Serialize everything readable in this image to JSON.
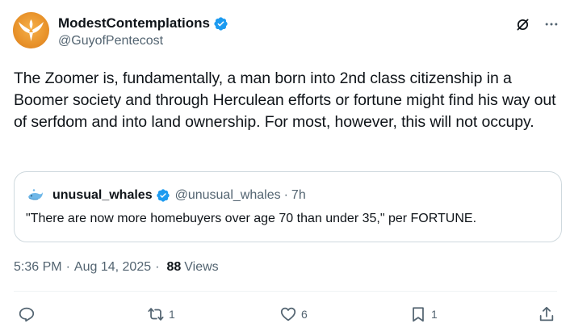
{
  "author": {
    "display_name": "ModestContemplations",
    "handle": "@GuyofPentecost",
    "verified": true
  },
  "tweet": {
    "text": "The Zoomer is, fundamentally, a man born into 2nd class citizenship in a Boomer society and through Herculean efforts or fortune might find his way out of serfdom and into land ownership. For most, however, this will not occupy."
  },
  "quoted": {
    "display_name": "unusual_whales",
    "handle": "@unusual_whales",
    "separator": "·",
    "time": "7h",
    "text": "\"There are now more homebuyers over age 70 than under 35,\" per FORTUNE."
  },
  "meta": {
    "time": "5:36 PM",
    "date": "Aug 14, 2025",
    "dot": "·",
    "views_count": "88",
    "views_label": "Views"
  },
  "actions": {
    "reply_count": "",
    "repost_count": "1",
    "like_count": "6",
    "bookmark_count": "1"
  },
  "colors": {
    "verified_blue": "#1d9bf0",
    "secondary_text": "#536471",
    "primary_text": "#0f1419",
    "border": "#cfd9de"
  },
  "icons": {
    "grok": "grok-icon",
    "more": "more-icon",
    "reply": "reply-icon",
    "repost": "repost-icon",
    "like": "heart-icon",
    "bookmark": "bookmark-icon",
    "share": "share-icon"
  }
}
